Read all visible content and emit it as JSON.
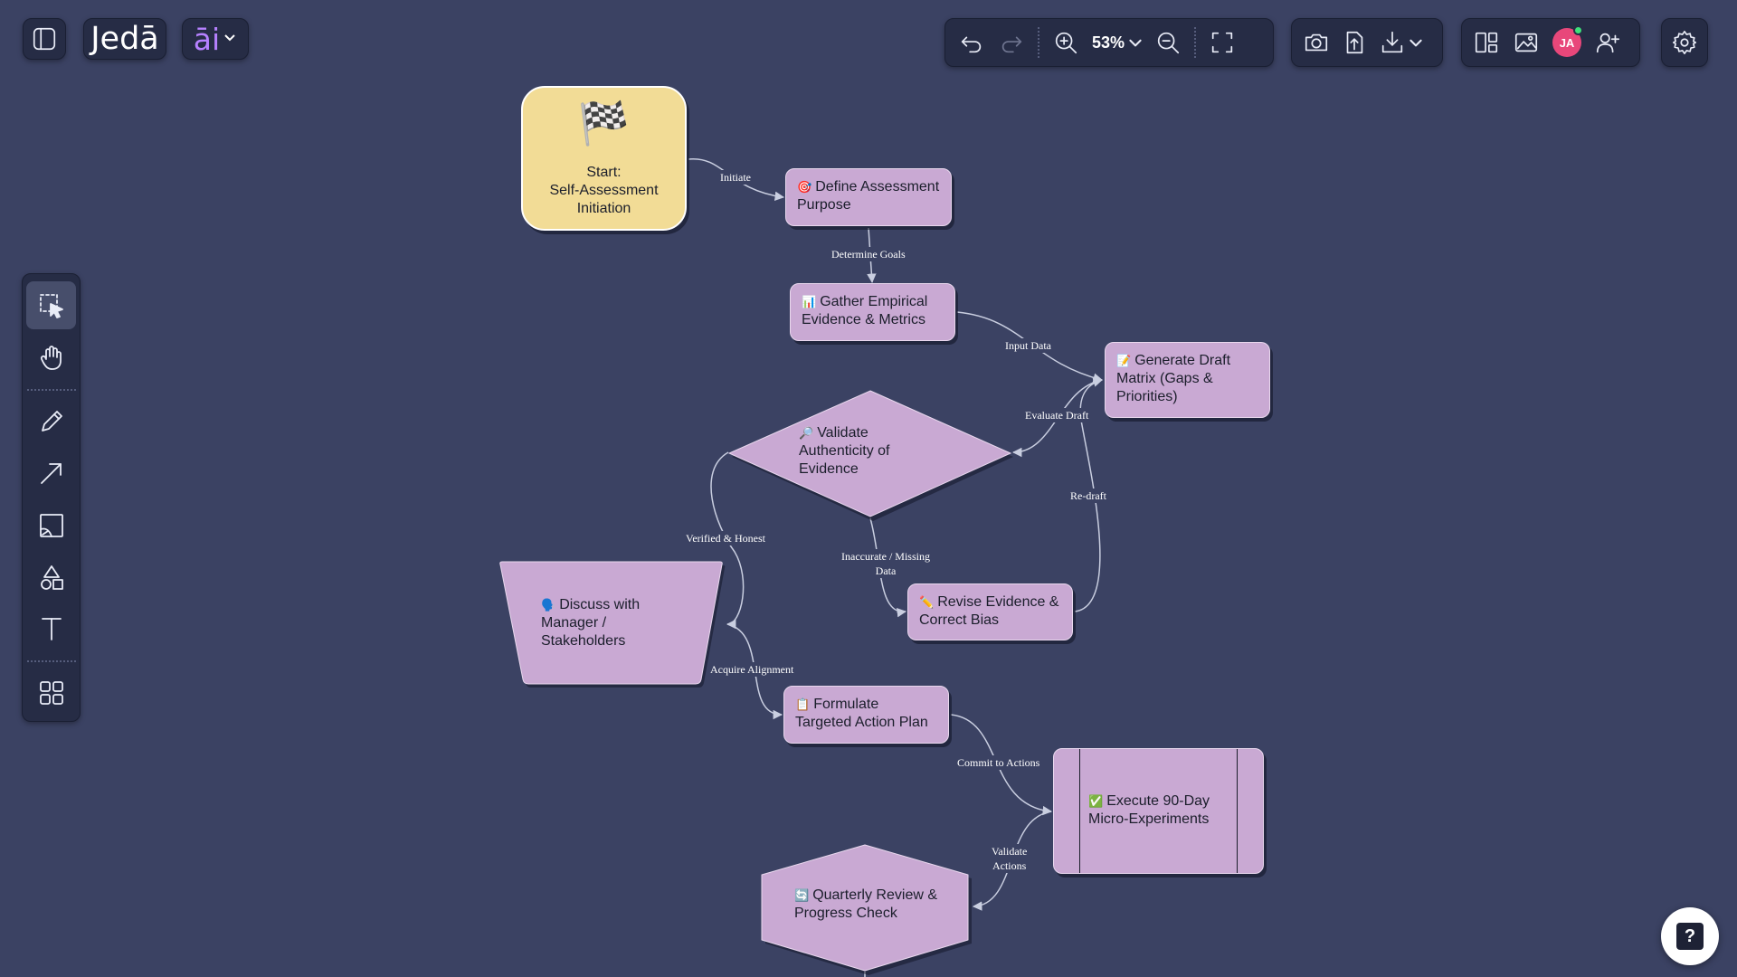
{
  "app": {
    "logo": "Jedā",
    "ai_label": "āi"
  },
  "toolbar": {
    "zoom_level": "53%",
    "avatar_initials": "JA"
  },
  "tools": [
    "select-tool",
    "hand-tool",
    "pencil-tool",
    "arrow-tool",
    "image-tool",
    "shapes-tool",
    "text-tool",
    "templates-tool"
  ],
  "nodes": {
    "start": {
      "icon": "🏁",
      "label": "Start:\nSelf-Assessment\nInitiation"
    },
    "define": {
      "icon": "🎯",
      "label": "Define Assessment Purpose"
    },
    "gather": {
      "icon": "📊",
      "label": "Gather Empirical Evidence & Metrics"
    },
    "generate": {
      "icon": "📝",
      "label": "Generate Draft Matrix (Gaps & Priorities)"
    },
    "validate": {
      "icon": "🔎",
      "label": "Validate Authenticity of Evidence"
    },
    "discuss": {
      "icon": "🗣️",
      "label": "Discuss with Manager / Stakeholders"
    },
    "revise": {
      "icon": "✏️",
      "label": "Revise Evidence & Correct Bias"
    },
    "formulate": {
      "icon": "📋",
      "label": "Formulate Targeted Action Plan"
    },
    "execute": {
      "icon": "✅",
      "label": "Execute 90-Day Micro-Experiments"
    },
    "quarterly": {
      "icon": "🔄",
      "label": "Quarterly Review & Progress Check"
    }
  },
  "edges": {
    "initiate": "Initiate",
    "determine_goals": "Determine Goals",
    "input_data": "Input Data",
    "evaluate_draft": "Evaluate Draft",
    "re_draft": "Re-draft",
    "verified_honest": "Verified & Honest",
    "inaccurate_missing": "Inaccurate / Missing\nData",
    "acquire_alignment": "Acquire Alignment",
    "commit_to_actions": "Commit to Actions",
    "validate_actions": "Validate\nActions"
  },
  "colors": {
    "canvas_bg": "#3b4263",
    "node_fill": "#c9a9d3",
    "start_fill": "#f2dc96",
    "accent": "#b681ff",
    "avatar": "#e8477a"
  },
  "help": {
    "icon": "help-icon",
    "label": "?"
  }
}
